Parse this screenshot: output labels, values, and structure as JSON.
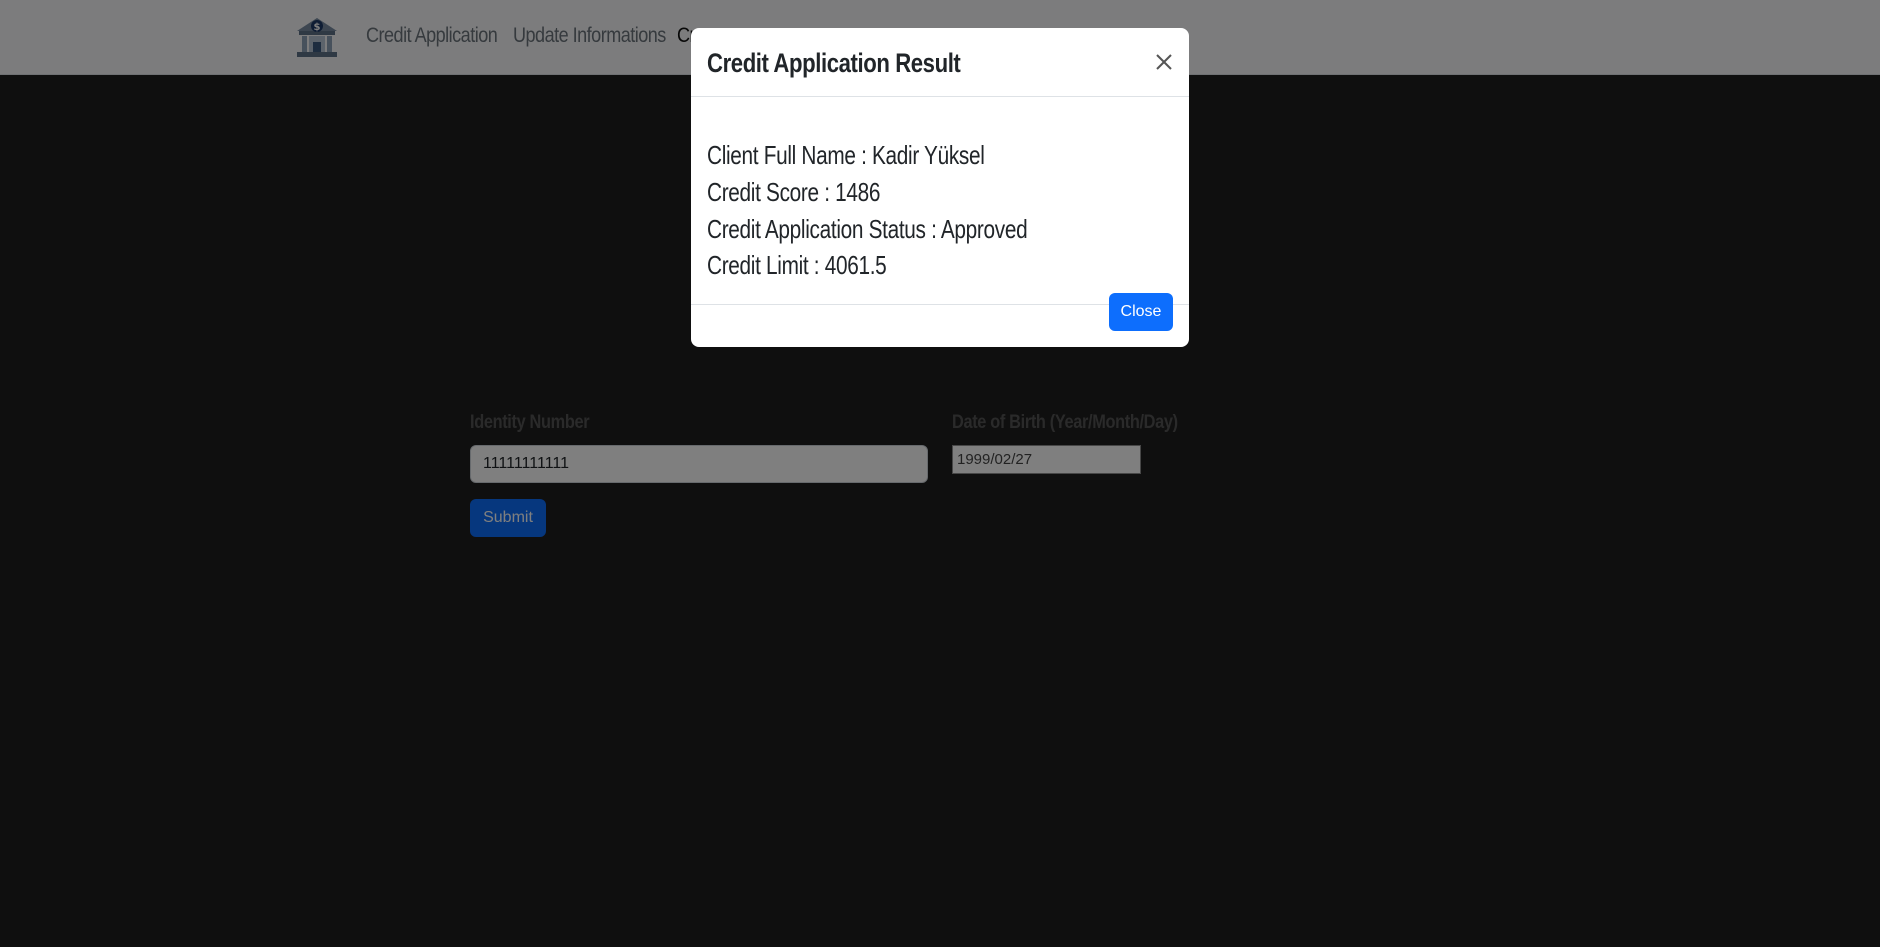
{
  "navbar": {
    "logo_icon": "bank-dollar-icon",
    "links": [
      {
        "label": "Credit Application"
      },
      {
        "label": "Update Informations"
      },
      {
        "label": "Cr"
      }
    ]
  },
  "form": {
    "identity_label": "Identity Number",
    "identity_value": "11111111111",
    "dob_label": "Date of Birth (Year/Month/Day)",
    "dob_value": "1999/02/27",
    "submit_label": "Submit"
  },
  "modal": {
    "title": "Credit Application Result",
    "close_icon": "close-icon",
    "lines": [
      "Client Full Name : Kadir Yüksel",
      "Credit Score : 1486",
      "Credit Application Status : Approved",
      "Credit Limit : 4061.5"
    ],
    "close_label": "Close"
  },
  "colors": {
    "primary": "#0d6efd",
    "page_dark": "#1f1f1f",
    "navbar_bg": "#f8f9fa",
    "backdrop": "rgba(0,0,0,0.5)"
  }
}
